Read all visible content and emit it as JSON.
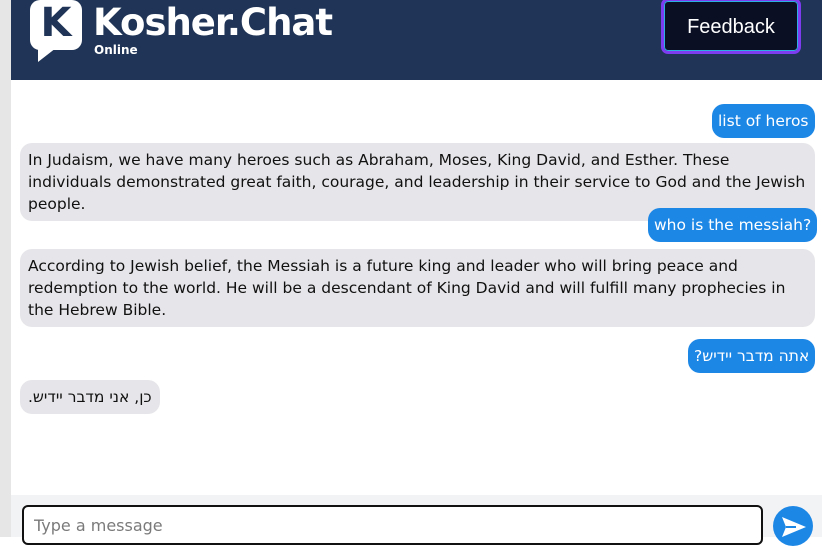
{
  "header": {
    "logo_letter": "K",
    "brand": "Kosher.Chat",
    "status": "Online",
    "feedback_label": "Feedback"
  },
  "messages": [
    {
      "role": "user",
      "text": "list of heros"
    },
    {
      "role": "bot",
      "text": "In Judaism, we have many heroes such as Abraham, Moses, King David, and Esther. These individuals demonstrated great faith, courage, and leadership in their service to God and the Jewish people."
    },
    {
      "role": "user",
      "text": "who is the messiah?"
    },
    {
      "role": "bot",
      "text": "According to Jewish belief, the Messiah is a future king and leader who will bring peace and redemption to the world. He will be a descendant of King David and will fulfill many prophecies in the Hebrew Bible."
    },
    {
      "role": "user",
      "text": "אתה מדבר יידיש?"
    },
    {
      "role": "bot",
      "text": "כן, אני מדבר יידיש."
    }
  ],
  "composer": {
    "placeholder": "Type a message",
    "send_icon": "send-arrow-icon"
  },
  "colors": {
    "header_bg": "#1f3456",
    "user_bubble": "#1d87e6",
    "bot_bubble": "#e6e6ea",
    "feedback_border": "#7d3cf0"
  }
}
